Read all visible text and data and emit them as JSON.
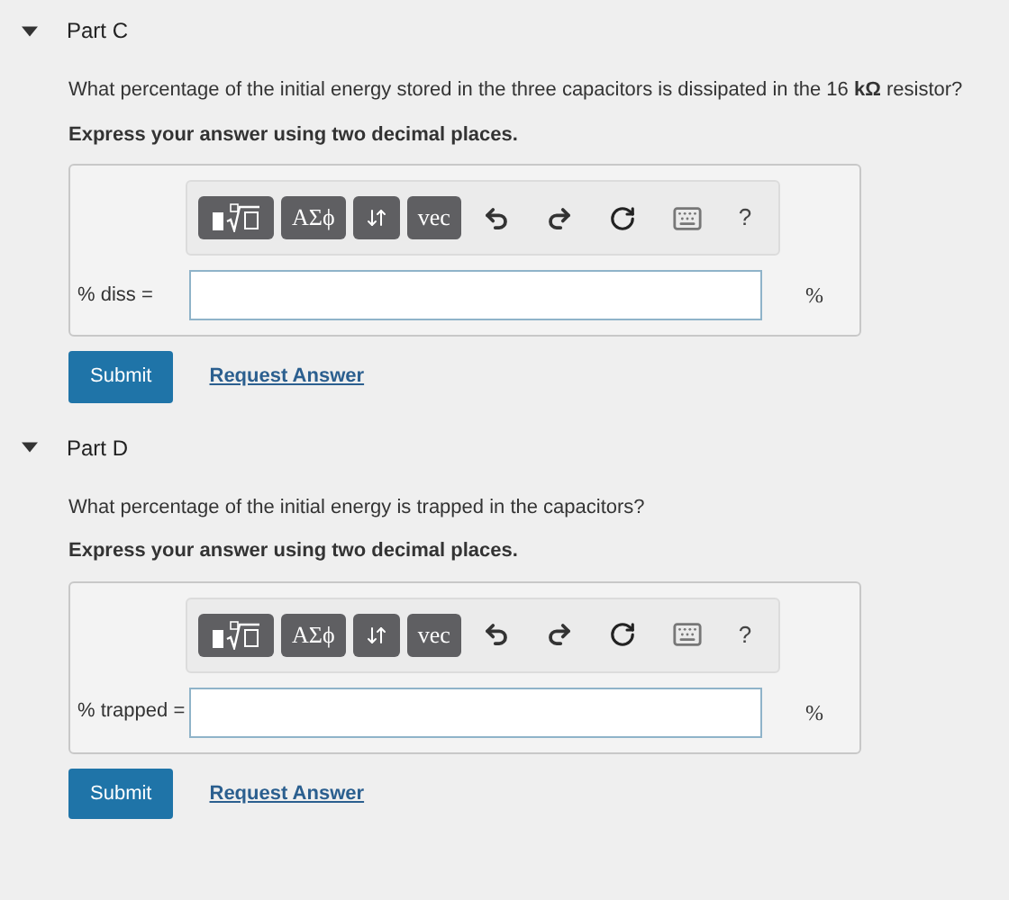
{
  "parts": [
    {
      "title": "Part C",
      "expanded": true,
      "question": "What percentage of the initial energy stored in the three capacitors is dissipated in the 16 **kΩ** resistor?",
      "instruction": "Express your answer using two decimal places.",
      "toolbar": [
        {
          "kind": "templates"
        },
        {
          "kind": "text",
          "label": "ΑΣϕ"
        },
        {
          "kind": "arrows"
        },
        {
          "kind": "text",
          "label": "vec"
        },
        {
          "kind": "undo"
        },
        {
          "kind": "redo"
        },
        {
          "kind": "reset"
        },
        {
          "kind": "keyboard"
        },
        {
          "kind": "help",
          "label": "?"
        }
      ],
      "answer_label": "% diss =",
      "unit": "%",
      "submit": "Submit",
      "request": "Request Answer"
    },
    {
      "title": "Part D",
      "expanded": true,
      "question": "What percentage of the initial energy is trapped in the capacitors?",
      "instruction": "Express your answer using two decimal places.",
      "toolbar": [
        {
          "kind": "templates"
        },
        {
          "kind": "text",
          "label": "ΑΣϕ"
        },
        {
          "kind": "arrows"
        },
        {
          "kind": "text",
          "label": "vec"
        },
        {
          "kind": "undo"
        },
        {
          "kind": "redo"
        },
        {
          "kind": "reset"
        },
        {
          "kind": "keyboard"
        },
        {
          "kind": "help",
          "label": "?"
        }
      ],
      "answer_label": "% trapped =",
      "unit": "%",
      "submit": "Submit",
      "request": "Request Answer"
    }
  ]
}
